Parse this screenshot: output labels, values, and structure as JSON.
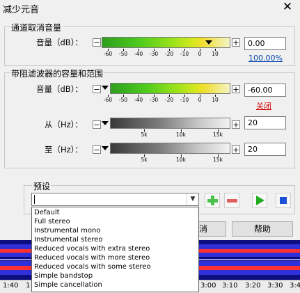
{
  "window": {
    "title": "减少元音",
    "close_glyph": "✕"
  },
  "center_channel": {
    "group_title": "通道取消音量",
    "volume_label": "音量（dB）：",
    "minus": "−",
    "plus": "+",
    "scale": [
      "-60",
      "-50",
      "-40",
      "-30",
      "-20",
      "-10",
      "0",
      "10"
    ],
    "value": "0.00",
    "percent_link": "100.00%"
  },
  "bandpass": {
    "group_title": "带阻滤波器的容量和范围",
    "volume_label": "音量（dB）：",
    "volume_value": "-60.00",
    "volume_scale": [
      "-60",
      "-50",
      "-40",
      "-30",
      "-20",
      "-10",
      "0",
      "10"
    ],
    "off_link": "关闭",
    "from_label": "从（Hz）：",
    "from_value": "20",
    "to_label": "至（Hz）：",
    "to_value": "20",
    "freq_scale": [
      "5k",
      "10k",
      "15k"
    ],
    "minus": "−",
    "plus": "+"
  },
  "presets": {
    "group_title": "预设",
    "current_value": "",
    "options": [
      "Default",
      "Full stereo",
      "Instrumental mono",
      "Instrumental stereo",
      "Reduced vocals with extra stereo",
      "Reduced vocals with more stereo",
      "Reduced vocals with some stereo",
      "Simple bandstop",
      "Simple cancellation"
    ]
  },
  "buttons": {
    "cancel_partial": "消",
    "help": "帮助"
  },
  "timeline": {
    "left_labels": [
      "1:40",
      "1"
    ],
    "labels": [
      "3:00",
      "3:10",
      "3:20",
      "3:30",
      "3:40"
    ]
  },
  "colors": {
    "play_green": "#22aa22",
    "stop_blue": "#1a4fd8",
    "add_green": "#4cc24c",
    "remove_red": "#e06060"
  }
}
